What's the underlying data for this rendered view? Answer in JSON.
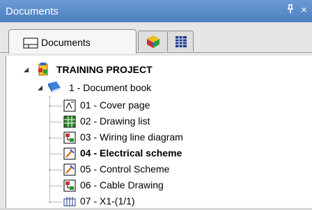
{
  "window": {
    "title": "Documents",
    "pin_glyph": "ㅁ",
    "close_glyph": "×"
  },
  "tabs": [
    {
      "label": "Documents",
      "icon": "document-tab-icon"
    },
    {
      "label": "",
      "icon": "cube-icon"
    },
    {
      "label": "",
      "icon": "grid-icon"
    }
  ],
  "tree": {
    "root": {
      "label": "TRAINING PROJECT",
      "icon": "project-icon",
      "expanded": true
    },
    "book": {
      "label": "1 - Document book",
      "icon": "book-icon",
      "expanded": true
    },
    "pages": [
      {
        "label": "01 - Cover page",
        "icon": "cover-page-icon",
        "bold": false
      },
      {
        "label": "02 - Drawing list",
        "icon": "drawing-list-icon",
        "bold": false
      },
      {
        "label": "03 - Wiring line diagram",
        "icon": "wiring-diagram-icon",
        "bold": false
      },
      {
        "label": "04 - Electrical scheme",
        "icon": "electrical-scheme-icon",
        "bold": true
      },
      {
        "label": "05 - Control Scheme",
        "icon": "control-scheme-icon",
        "bold": false
      },
      {
        "label": "06 - Cable Drawing",
        "icon": "cable-drawing-icon",
        "bold": false
      },
      {
        "label": "07 - X1-(1/1)",
        "icon": "terminal-strip-icon",
        "bold": false
      }
    ]
  }
}
